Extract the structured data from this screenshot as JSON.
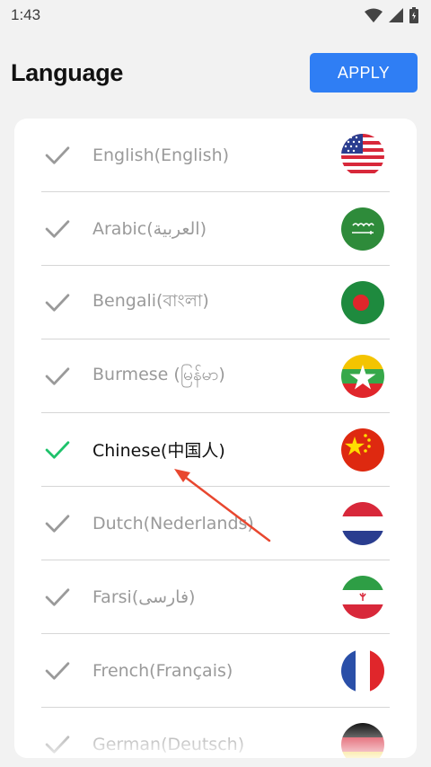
{
  "status_bar": {
    "time": "1:43"
  },
  "header": {
    "title": "Language",
    "apply_label": "APPLY"
  },
  "languages": [
    {
      "label": "English(English)",
      "selected": false,
      "flag": "us-flag-icon"
    },
    {
      "label": "Arabic(العربية)",
      "selected": false,
      "flag": "saudi-flag-icon"
    },
    {
      "label": "Bengali(বাংলা)",
      "selected": false,
      "flag": "bangladesh-flag-icon"
    },
    {
      "label": "Burmese (မြန်မာ)",
      "selected": false,
      "flag": "myanmar-flag-icon"
    },
    {
      "label": "Chinese(中国人)",
      "selected": true,
      "flag": "china-flag-icon"
    },
    {
      "label": "Dutch(Nederlands)",
      "selected": false,
      "flag": "netherlands-flag-icon"
    },
    {
      "label": "Farsi(فارسی)",
      "selected": false,
      "flag": "iran-flag-icon"
    },
    {
      "label": "French(Français)",
      "selected": false,
      "flag": "france-flag-icon"
    },
    {
      "label": "German(Deutsch)",
      "selected": false,
      "flag": "germany-flag-icon"
    }
  ],
  "colors": {
    "accent": "#2f7ef4",
    "check_selected": "#1ec26b",
    "check_unselected": "#9a9a9a",
    "annotation": "#e8472f"
  }
}
